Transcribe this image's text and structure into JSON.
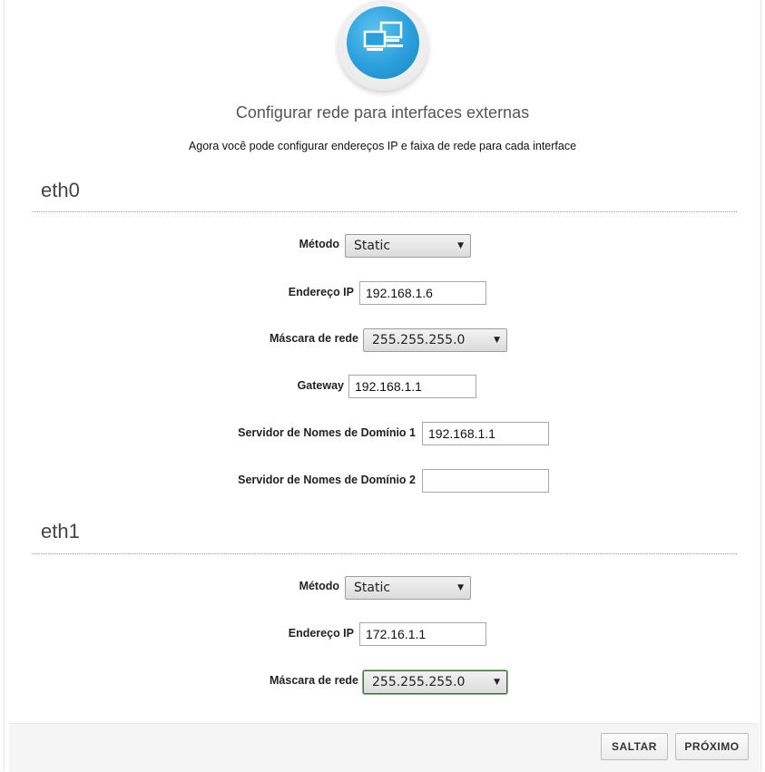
{
  "header": {
    "logo_icon": "network-computers-icon",
    "title": "Configurar rede para interfaces externas",
    "subtitle": "Agora você pode configurar endereços IP e faixa de rede para cada interface"
  },
  "interfaces": [
    {
      "name": "eth0",
      "method_label": "Método",
      "method_value": "Static",
      "ip_label": "Endereço IP",
      "ip_value": "192.168.1.6",
      "netmask_label": "Máscara de rede",
      "netmask_value": "255.255.255.0",
      "gateway_label": "Gateway",
      "gateway_value": "192.168.1.1",
      "dns1_label": "Servidor de Nomes de Domínio 1",
      "dns1_value": "192.168.1.1",
      "dns2_label": "Servidor de Nomes de Domínio 2",
      "dns2_value": ""
    },
    {
      "name": "eth1",
      "method_label": "Método",
      "method_value": "Static",
      "ip_label": "Endereço IP",
      "ip_value": "172.16.1.1",
      "netmask_label": "Máscara de rede",
      "netmask_value": "255.255.255.0"
    }
  ],
  "footer": {
    "skip_label": "SALTAR",
    "next_label": "PRÓXIMO"
  }
}
